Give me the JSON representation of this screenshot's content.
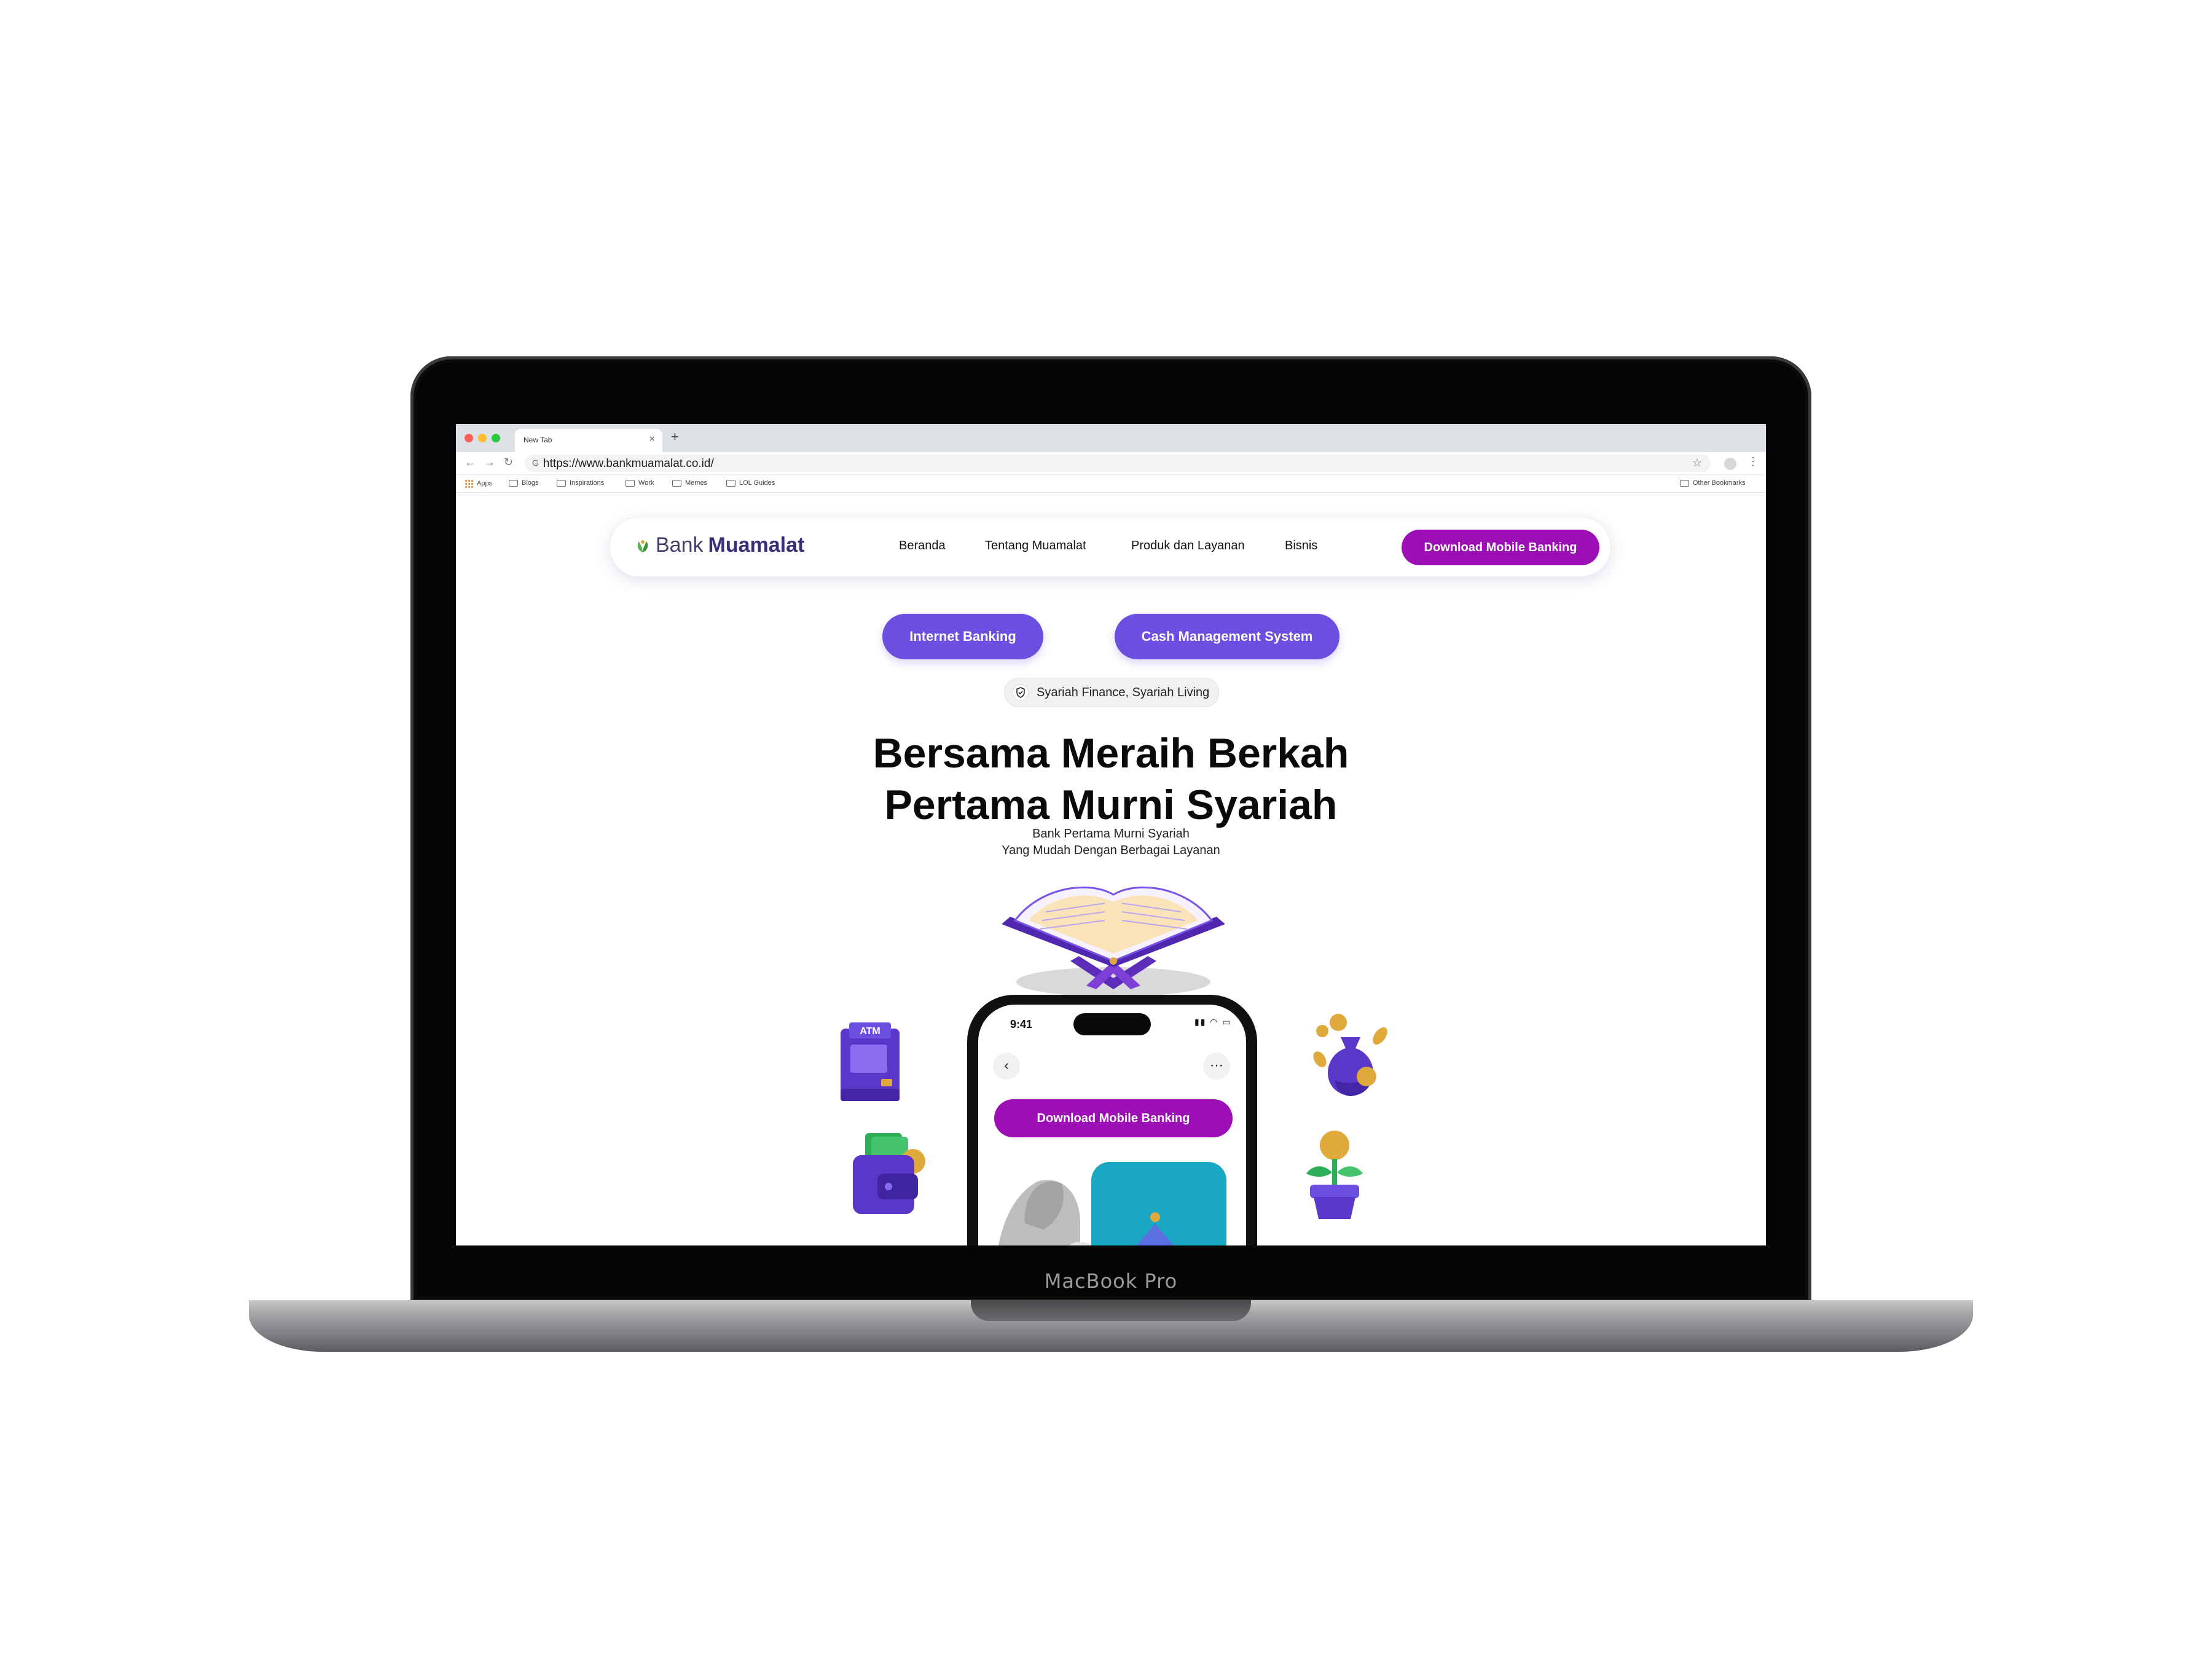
{
  "device": {
    "label": "MacBook Pro"
  },
  "browser": {
    "tab_title": "New Tab",
    "url": "https://www.bankmuamalat.co.id/",
    "bookmarks": [
      "Apps",
      "Blogs",
      "Inspirations",
      "Work",
      "Memes",
      "LOL Guides"
    ],
    "other_bookmarks": "Other Bookmarks"
  },
  "site": {
    "logo_bank": "Bank",
    "logo_name": "Muamalat",
    "nav": [
      "Beranda",
      "Tentang Muamalat",
      "Produk dan Layanan",
      "Bisnis"
    ],
    "nav_cta": "Download Mobile Banking",
    "quick_buttons": [
      "Internet Banking",
      "Cash Management System"
    ],
    "badge": "Syariah Finance, Syariah Living",
    "hero_title_line1": "Bersama Meraih Berkah",
    "hero_title_line2": "Pertama Murni Syariah",
    "hero_sub_line1": "Bank Pertama Murni Syariah",
    "hero_sub_line2": "Yang Mudah Dengan Berbagai Layanan",
    "atm_label": "ATM"
  },
  "phone": {
    "time": "9:41",
    "cta": "Download Mobile Banking"
  },
  "colors": {
    "primary_purple": "#6b4fe0",
    "magenta": "#9b0fb4",
    "gold": "#e0a93b",
    "teal": "#1aa7c4"
  }
}
